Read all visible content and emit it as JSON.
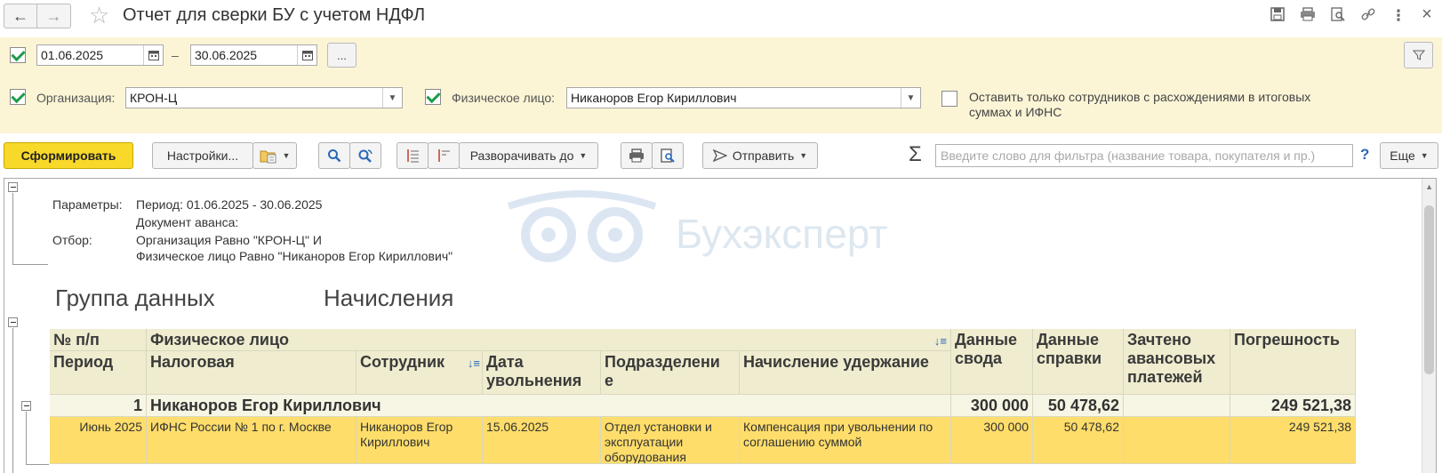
{
  "window": {
    "title": "Отчет для сверки БУ с учетом НДФЛ"
  },
  "filters": {
    "period_from": "01.06.2025",
    "period_dash": "–",
    "period_to": "30.06.2025",
    "period_more": "...",
    "org_label": "Организация:",
    "org_value": "КРОН-Ц",
    "person_label": "Физическое лицо:",
    "person_value": "Никаноров Егор Кириллович",
    "only_diff_label_line1": "Оставить только сотрудников с расхождениями в итоговых",
    "only_diff_label_line2": "суммах и ИФНС",
    "period_checked": true,
    "org_checked": true,
    "person_checked": true,
    "only_diff_checked": false
  },
  "toolbar": {
    "generate": "Сформировать",
    "settings": "Настройки...",
    "expand_to": "Разворачивать до",
    "send": "Отправить",
    "sigma": "Σ",
    "search_placeholder": "Введите слово для фильтра (название товара, покупателя и пр.)",
    "help": "?",
    "more": "Еще"
  },
  "report": {
    "params_label": "Параметры:",
    "params_period": "Период: 01.06.2025 - 30.06.2025",
    "params_advance_doc": "Документ аванса:",
    "filter_label": "Отбор:",
    "filter_line1": "Организация Равно \"КРОН-Ц\" И",
    "filter_line2": "Физическое лицо Равно \"Никаноров Егор Кириллович\"",
    "group_data": "Группа данных",
    "group_accruals": "Начисления",
    "watermark": "Бухэксперт",
    "columns": {
      "num": "№ п/п",
      "person": "Физическое лицо",
      "period": "Период",
      "tax_office": "Налоговая",
      "employee": "Сотрудник",
      "dismissal_date_1": "Дата",
      "dismissal_date_2": "увольнения",
      "department_1": "Подразделени",
      "department_2": "е",
      "accrual": "Начисление удержание",
      "summary_1": "Данные",
      "summary_2": "свода",
      "certificate_1": "Данные",
      "certificate_2": "справки",
      "advance_1": "Зачтено",
      "advance_2": "авансовых",
      "advance_3": "платежей",
      "error": "Погрешность"
    },
    "group_row": {
      "num": "1",
      "person": "Никаноров Егор Кириллович",
      "summary": "300 000",
      "certificate": "50 478,62",
      "advance": "",
      "error": "249 521,38"
    },
    "detail_row": {
      "period": "Июнь 2025",
      "tax_office": "ИФНС России № 1 по г. Москве",
      "employee_1": "Никаноров Егор",
      "employee_2": "Кириллович",
      "dismissal_date": "15.06.2025",
      "department_1": "Отдел установки и",
      "department_2": "эксплуатации",
      "department_3": "оборудования",
      "accrual_1": "Компенсация при увольнении по",
      "accrual_2": "соглашению суммой",
      "summary": "300 000",
      "certificate": "50 478,62",
      "advance": "",
      "error": "249 521,38"
    }
  }
}
